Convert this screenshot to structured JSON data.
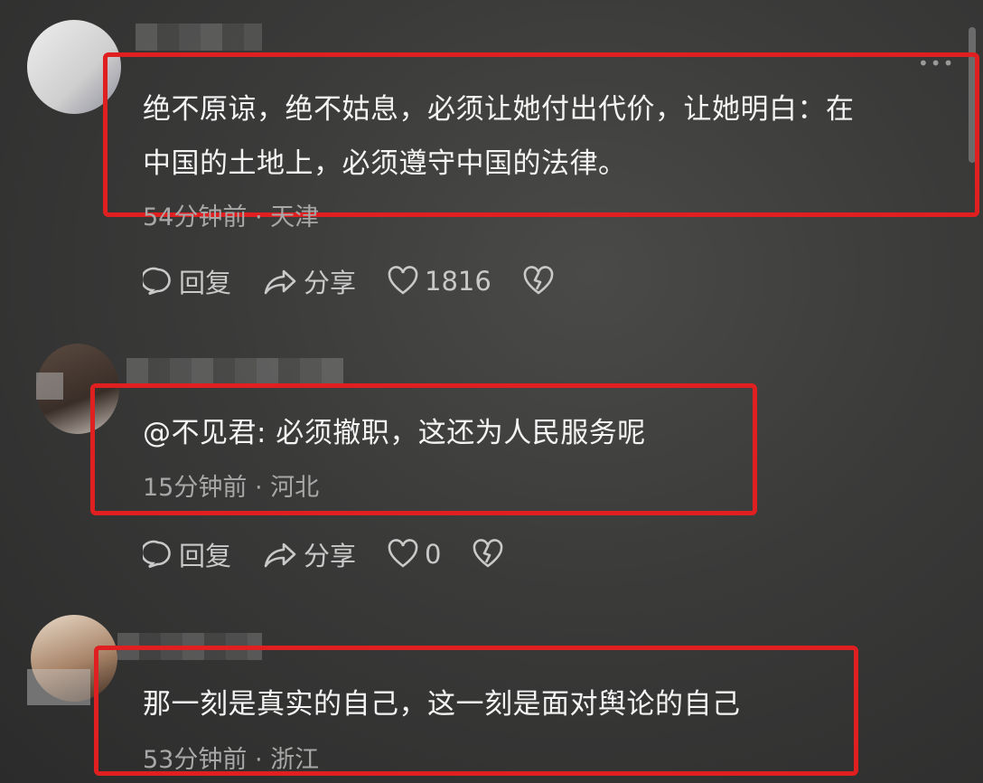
{
  "comments": [
    {
      "text_line1": "绝不原谅，绝不姑息，必须让她付出代价，让她明白：在",
      "text_line2": "中国的土地上，必须遵守中国的法律。",
      "meta": "54分钟前 · 天津",
      "reply_label": "回复",
      "share_label": "分享",
      "like_count": "1816"
    },
    {
      "text": "@不见君: 必须撤职，这还为人民服务呢",
      "meta": "15分钟前 · 河北",
      "reply_label": "回复",
      "share_label": "分享",
      "like_count": "0"
    },
    {
      "text": "那一刻是真实的自己，这一刻是面对舆论的自己",
      "meta": "53分钟前 · 浙江"
    }
  ],
  "colors": {
    "highlight": "#e02020",
    "meta": "#a8a8a8",
    "text": "#f4f4f4"
  }
}
